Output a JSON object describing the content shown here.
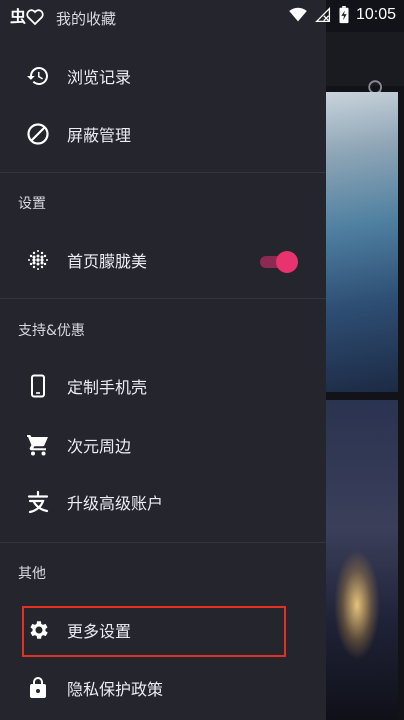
{
  "status_bar": {
    "app_title": "我的收藏",
    "time": "10:05"
  },
  "menu": {
    "history": "浏览记录",
    "block_manage": "屏蔽管理"
  },
  "sections": {
    "settings": "设置",
    "support": "支持&优惠",
    "other": "其他"
  },
  "settings": {
    "home_blur": "首页朦胧美",
    "home_blur_enabled": true
  },
  "support": {
    "custom_case": "定制手机壳",
    "merch": "次元周边",
    "upgrade": "升级高级账户"
  },
  "other": {
    "more_settings": "更多设置",
    "privacy": "隐私保护政策"
  },
  "colors": {
    "drawer_bg": "#25252e",
    "toggle_on": "#e8336f",
    "highlight": "#e03224"
  }
}
